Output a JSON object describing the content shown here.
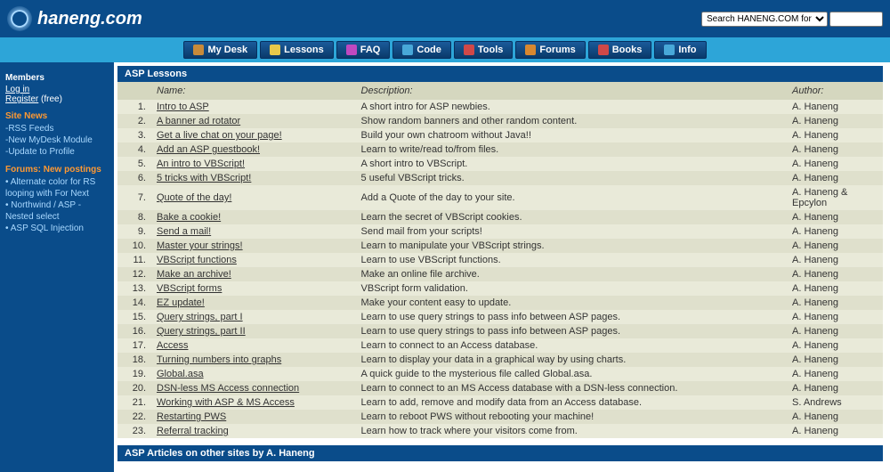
{
  "header": {
    "logo": "haneng.com"
  },
  "search": {
    "placeholder": "Search HANENG.COM for"
  },
  "nav": [
    {
      "label": "My Desk",
      "color": "#c88a3a"
    },
    {
      "label": "Lessons",
      "color": "#e8c84a"
    },
    {
      "label": "FAQ",
      "color": "#c048c0"
    },
    {
      "label": "Code",
      "color": "#48a8d8"
    },
    {
      "label": "Tools",
      "color": "#d04848"
    },
    {
      "label": "Forums",
      "color": "#d88830"
    },
    {
      "label": "Books",
      "color": "#d04848"
    },
    {
      "label": "Info",
      "color": "#48a8d8"
    }
  ],
  "sidebar": {
    "members_head": "Members",
    "login": "Log in",
    "register": "Register",
    "register_free": " (free)",
    "sitenews_head": "Site News",
    "sitenews": [
      "-RSS Feeds",
      "-New MyDesk Module",
      "-Update to Profile"
    ],
    "forums_head": "Forums: New postings",
    "forums": [
      "• Alternate color for RS looping with For Next",
      "• Northwind / ASP - Nested select",
      "• ASP SQL Injection"
    ]
  },
  "panel1_title": "ASP Lessons",
  "cols": {
    "name": "Name:",
    "desc": "Description:",
    "author": "Author:"
  },
  "lessons": [
    {
      "n": 1,
      "name": "Intro to ASP",
      "desc": "A short intro for ASP newbies.",
      "author": "A. Haneng"
    },
    {
      "n": 2,
      "name": "A banner ad rotator",
      "desc": "Show random banners and other random content.",
      "author": "A. Haneng"
    },
    {
      "n": 3,
      "name": "Get a live chat on your page!",
      "desc": "Build your own chatroom without Java!!",
      "author": "A. Haneng"
    },
    {
      "n": 4,
      "name": "Add an ASP guestbook!",
      "desc": "Learn to write/read to/from files.",
      "author": "A. Haneng"
    },
    {
      "n": 5,
      "name": "An intro to VBScript!",
      "desc": "A short intro to VBScript.",
      "author": "A. Haneng"
    },
    {
      "n": 6,
      "name": "5 tricks with VBScript!",
      "desc": "5 useful VBScript tricks.",
      "author": "A. Haneng"
    },
    {
      "n": 7,
      "name": "Quote of the day!",
      "desc": "Add a Quote of the day to your site.",
      "author": "A. Haneng & Epcylon"
    },
    {
      "n": 8,
      "name": "Bake a cookie!",
      "desc": "Learn the secret of VBScript cookies.",
      "author": "A. Haneng"
    },
    {
      "n": 9,
      "name": "Send a mail!",
      "desc": "Send mail from your scripts!",
      "author": "A. Haneng"
    },
    {
      "n": 10,
      "name": "Master your strings!",
      "desc": "Learn to manipulate your VBScript strings.",
      "author": "A. Haneng"
    },
    {
      "n": 11,
      "name": "VBScript functions",
      "desc": "Learn to use VBScript functions.",
      "author": "A. Haneng"
    },
    {
      "n": 12,
      "name": "Make an archive!",
      "desc": "Make an online file archive.",
      "author": "A. Haneng"
    },
    {
      "n": 13,
      "name": "VBScript forms",
      "desc": "VBScript form validation.",
      "author": "A. Haneng"
    },
    {
      "n": 14,
      "name": "EZ update!",
      "desc": "Make your content easy to update.",
      "author": "A. Haneng"
    },
    {
      "n": 15,
      "name": "Query strings, part I",
      "desc": "Learn to use query strings to pass info between ASP pages.",
      "author": "A. Haneng"
    },
    {
      "n": 16,
      "name": "Query strings, part II",
      "desc": "Learn to use query strings to pass info between ASP pages.",
      "author": "A. Haneng"
    },
    {
      "n": 17,
      "name": "Access",
      "desc": "Learn to connect to an Access database.",
      "author": "A. Haneng"
    },
    {
      "n": 18,
      "name": "Turning numbers into graphs",
      "desc": "Learn to display your data in a graphical way by using charts.",
      "author": "A. Haneng"
    },
    {
      "n": 19,
      "name": "Global.asa",
      "desc": "A quick guide to the mysterious file called Global.asa.",
      "author": "A. Haneng"
    },
    {
      "n": 20,
      "name": "DSN-less MS Access connection",
      "desc": "Learn to connect to an MS Access database with a DSN-less connection.",
      "author": "A. Haneng"
    },
    {
      "n": 21,
      "name": "Working with ASP & MS Access",
      "desc": "Learn to add, remove and modify data from an Access database.",
      "author": "S. Andrews"
    },
    {
      "n": 22,
      "name": "Restarting PWS",
      "desc": "Learn to reboot PWS without rebooting your machine!",
      "author": "A. Haneng"
    },
    {
      "n": 23,
      "name": "Referral tracking",
      "desc": "Learn how to track where your visitors come from.",
      "author": "A. Haneng"
    }
  ],
  "panel2_title": "ASP Articles on other sites by A. Haneng"
}
